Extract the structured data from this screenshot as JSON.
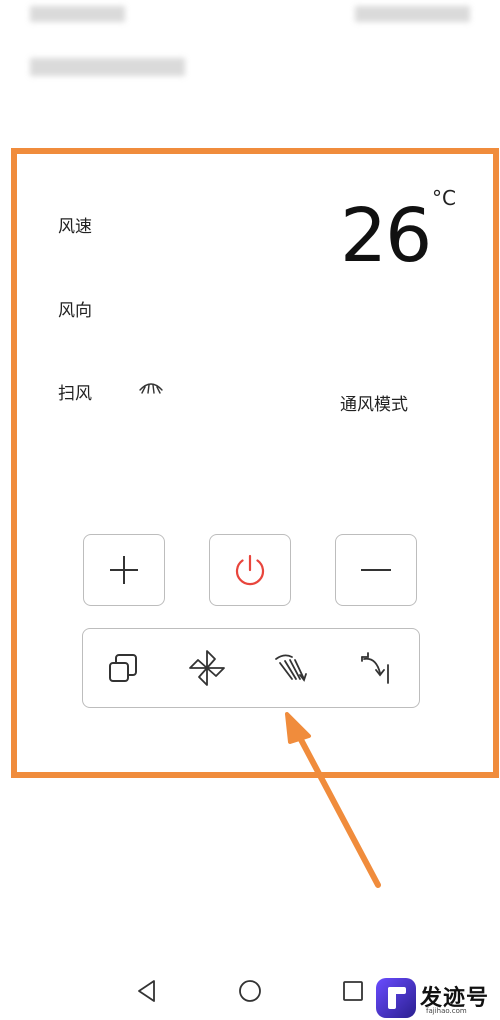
{
  "panel": {
    "wind_speed_label": "风速",
    "wind_direction_label": "风向",
    "sweep_label": "扫风",
    "sweep_icon": "fan-sweep-icon",
    "temperature": "26",
    "temperature_unit": "°C",
    "mode_label": "通风模式"
  },
  "controls": {
    "plus_icon": "plus-icon",
    "power_icon": "power-icon",
    "minus_icon": "minus-icon",
    "power_color": "#e8453c"
  },
  "functions": {
    "icons": [
      "mode-icon",
      "fan-icon",
      "sweep-direction-icon",
      "timer-icon"
    ]
  },
  "highlight_color": "#f08c3c",
  "navbar": {
    "icons": [
      "back-icon",
      "home-icon",
      "recents-icon"
    ]
  },
  "watermark": {
    "text": "发迹号",
    "sub": "fajihao.com"
  }
}
